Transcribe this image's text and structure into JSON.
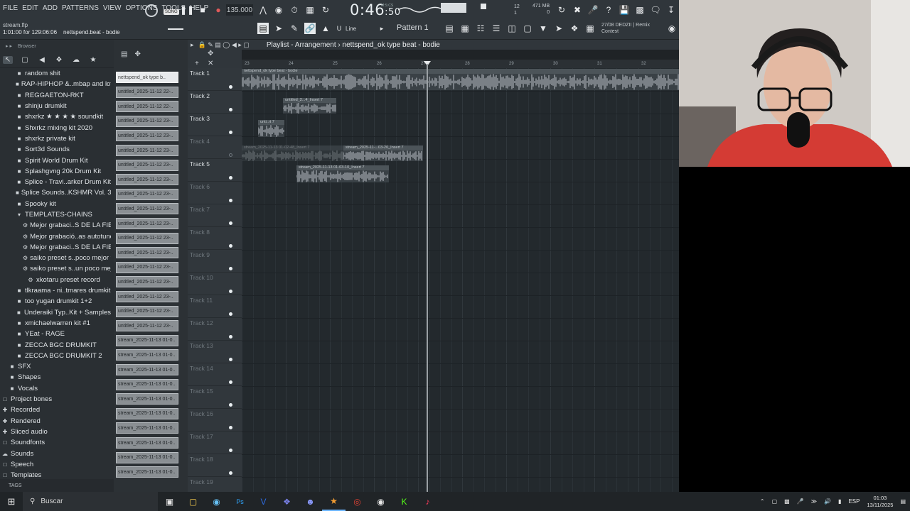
{
  "menu": [
    "FILE",
    "EDIT",
    "ADD",
    "PATTERNS",
    "VIEW",
    "OPTIONS",
    "TOOLS",
    "HELP"
  ],
  "transport": {
    "song_label": "SONG",
    "tempo": "135.000",
    "time": "0:46",
    "time_small": ":50",
    "time_unit": "M:S:CS"
  },
  "status": {
    "cpu_top": "12",
    "cpu_bottom": "1",
    "mem": "471 MB",
    "mem_sub": "0"
  },
  "file": {
    "name": "stream.flp",
    "position": "1:01:00 for 129:06:06",
    "channel": "nettspend.beat - bodie"
  },
  "pattern": {
    "label": "Pattern 1",
    "snap": "Line"
  },
  "news": {
    "date": "27/08",
    "line1": "DEDZII | Remix",
    "line2": "Contest"
  },
  "browser": {
    "title": "Browser",
    "items": [
      {
        "label": "random shit",
        "icon": "folder"
      },
      {
        "label": "RAP-HIPHOP &..mbap and lofi",
        "icon": "folder"
      },
      {
        "label": "REGGAETON-RKT",
        "icon": "folder"
      },
      {
        "label": "shinju drumkit",
        "icon": "folder"
      },
      {
        "label": "shxrkz ★ ★ ★ ★ soundkit",
        "icon": "folder"
      },
      {
        "label": "Shxrkz mixing kit 2020",
        "icon": "folder"
      },
      {
        "label": "shxrkz private kit",
        "icon": "folder"
      },
      {
        "label": "Sort3d Sounds",
        "icon": "folder"
      },
      {
        "label": "Spirit World Drum Kit",
        "icon": "folder"
      },
      {
        "label": "Splashgvng 20k Drum Kit",
        "icon": "folder"
      },
      {
        "label": "Splice - Travi..arker Drum Kit",
        "icon": "folder"
      },
      {
        "label": "Splice Sounds..KSHMR Vol. 3",
        "icon": "folder"
      },
      {
        "label": "Spooky kit",
        "icon": "folder"
      },
      {
        "label": "TEMPLATES-CHAINS",
        "icon": "folder-open"
      },
      {
        "label": "Mejor grabaci..S DE LA FIESTA",
        "icon": "gear"
      },
      {
        "label": "Mejor grabació..as autotune)",
        "icon": "gear"
      },
      {
        "label": "Mejor grabaci..S DE LA FIESTA",
        "icon": "gear"
      },
      {
        "label": "saiko preset s..poco mejor v2",
        "icon": "gear"
      },
      {
        "label": "saiko preset s..un poco mejor",
        "icon": "gear"
      },
      {
        "label": "xkotaru preset record",
        "icon": "gear"
      },
      {
        "label": "tlkraama - ni..tmares drumkit",
        "icon": "folder"
      },
      {
        "label": "too yugan drumkit 1+2",
        "icon": "folder"
      },
      {
        "label": "Underaiki Typ..Kit + Samples",
        "icon": "folder"
      },
      {
        "label": "xmichaelwarren kit #1",
        "icon": "folder"
      },
      {
        "label": "YEat - RAGE",
        "icon": "folder"
      },
      {
        "label": "ZECCA BGC DRUMKIT",
        "icon": "folder"
      },
      {
        "label": "ZECCA BGC DRUMKIT 2",
        "icon": "folder"
      },
      {
        "label": "SFX",
        "icon": "folder"
      },
      {
        "label": "Shapes",
        "icon": "folder"
      },
      {
        "label": "Vocals",
        "icon": "folder"
      },
      {
        "label": "Project bones",
        "icon": "folder-outline"
      },
      {
        "label": "Recorded",
        "icon": "plus"
      },
      {
        "label": "Rendered",
        "icon": "plus"
      },
      {
        "label": "Sliced audio",
        "icon": "plus"
      },
      {
        "label": "Soundfonts",
        "icon": "folder-outline"
      },
      {
        "label": "Sounds",
        "icon": "cloud"
      },
      {
        "label": "Speech",
        "icon": "folder-outline"
      },
      {
        "label": "Templates",
        "icon": "folder-outline"
      }
    ],
    "tags_label": "TAGS"
  },
  "channels": [
    "nettspend_ok type b..",
    "untitled_2025-11-12 22-..",
    "untitled_2025-11-12 22-..",
    "untitled_2025-11-12 23-..",
    "untitled_2025-11-12 23-..",
    "untitled_2025-11-12 23-..",
    "untitled_2025-11-12 23-..",
    "untitled_2025-11-12 23-..",
    "untitled_2025-11-12 23-..",
    "untitled_2025-11-12 23-..",
    "untitled_2025-11-12 23-..",
    "untitled_2025-11-12 23-..",
    "untitled_2025-11-12 23-..",
    "untitled_2025-11-12 23-..",
    "untitled_2025-11-12 23-..",
    "untitled_2025-11-12 23-..",
    "untitled_2025-11-12 23-..",
    "untitled_2025-11-12 23-..",
    "stream_2025-11-13 01-0..",
    "stream_2025-11-13 01-0..",
    "stream_2025-11-13 01-0..",
    "stream_2025-11-13 01-0..",
    "stream_2025-11-13 01-0..",
    "stream_2025-11-13 01-0..",
    "stream_2025-11-13 01-0..",
    "stream_2025-11-13 01-0..",
    "stream_2025-11-13 01-0..",
    "stream_2025-11-13 01-0.."
  ],
  "playlist": {
    "prefix": "Playlist - Arrangement",
    "separator": "›",
    "name": "nettspend_ok type beat - bodie",
    "ruler": [
      "23",
      "24",
      "25",
      "26",
      "27",
      "28",
      "29",
      "30",
      "31",
      "32"
    ],
    "tracks": [
      "Track 1",
      "Track 2",
      "Track 3",
      "Track 4",
      "Track 5",
      "Track 6",
      "Track 7",
      "Track 8",
      "Track 9",
      "Track 10",
      "Track 11",
      "Track 12",
      "Track 13",
      "Track 14",
      "Track 15",
      "Track 16",
      "Track 17",
      "Track 18",
      "Track 19"
    ],
    "clips": [
      {
        "label": "nettspend_ok type beat - bodie",
        "track": 1
      },
      {
        "label": "untitled_2...4_Insert 7",
        "track": 2
      },
      {
        "label": "unti..rt 7",
        "track": 3
      },
      {
        "label": "stream_2025-11-13 01-02-48_Insert 7",
        "track": 4
      },
      {
        "label": "stream_2025-11-...03-20_Insert 7",
        "track": 4
      },
      {
        "label": "stream_2025-11-13 01-03-10_Insert 7",
        "track": 5
      }
    ]
  },
  "taskbar": {
    "search": "Buscar",
    "lang": "ESP",
    "time": "01:03",
    "date": "13/11/2025"
  }
}
